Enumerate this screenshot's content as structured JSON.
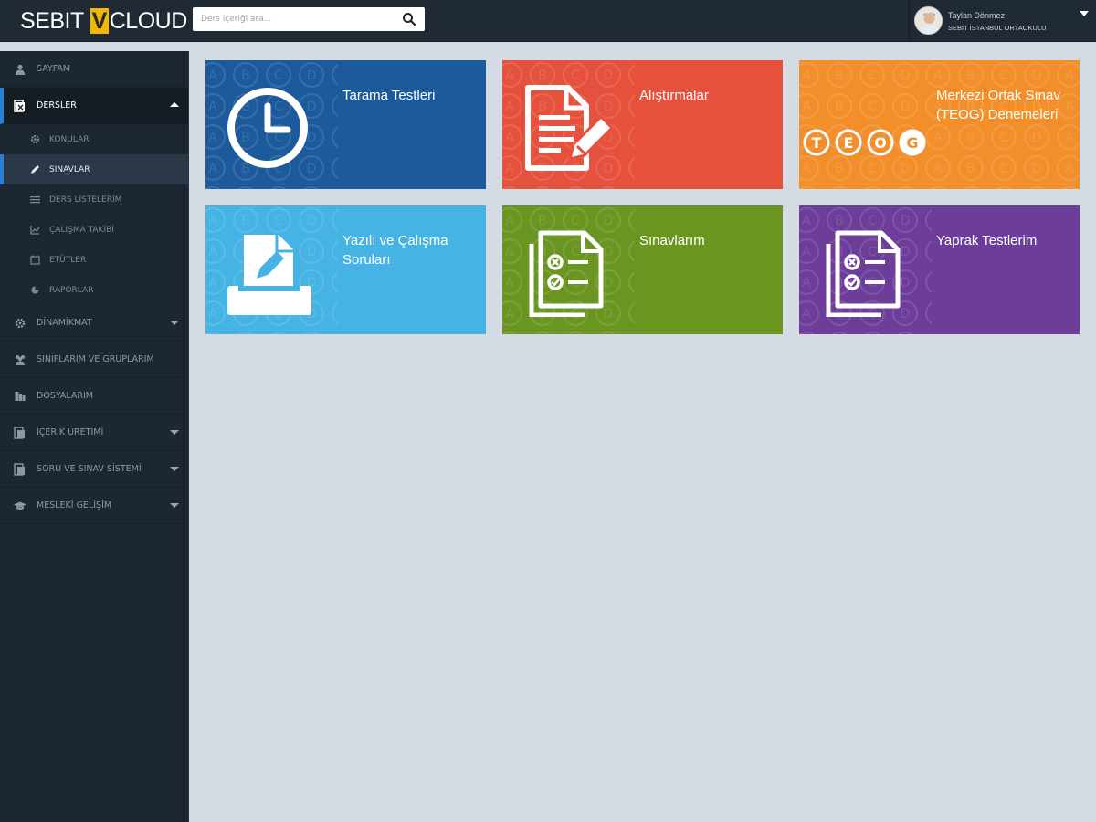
{
  "header": {
    "logo_left": "SEBIT",
    "logo_mark": "V",
    "logo_right": "CLOUD",
    "search_placeholder": "Ders içeriği ara...",
    "user_name": "Taylan Dönmez",
    "user_school": "SEBIT İSTANBUL ORTAOKULU"
  },
  "sidebar": {
    "items": [
      {
        "label": "SAYFAM",
        "icon": "user-icon"
      },
      {
        "label": "DERSLER",
        "icon": "book-icon",
        "active": true,
        "expanded": true
      },
      {
        "label": "KONULAR",
        "icon": "gear-icon"
      },
      {
        "label": "SINAVLAR",
        "icon": "pencil-icon",
        "active": true
      },
      {
        "label": "DERS LİSTELERİM",
        "icon": "list-icon"
      },
      {
        "label": "ÇALIŞMA TAKİBİ",
        "icon": "chart-icon"
      },
      {
        "label": "ETÜTLER",
        "icon": "calendar-icon"
      },
      {
        "label": "RAPORLAR",
        "icon": "report-icon"
      },
      {
        "label": "DİNAMİKMAT",
        "icon": "cog-icon"
      },
      {
        "label": "SINIFLARIM VE GRUPLARIM",
        "icon": "users-icon"
      },
      {
        "label": "DOSYALARIM",
        "icon": "files-icon"
      },
      {
        "label": "İÇERİK ÜRETİMİ",
        "icon": "content-icon"
      },
      {
        "label": "SORU VE SINAV SİSTEMİ",
        "icon": "question-icon"
      },
      {
        "label": "MESLEKİ GELİŞİM",
        "icon": "graduation-icon"
      }
    ]
  },
  "tiles": [
    {
      "label": "Tarama Testleri",
      "color": "#1c5a9c",
      "icon": "clock-icon"
    },
    {
      "label": "Alıştırmalar",
      "color": "#e5513d",
      "icon": "document-pencil-icon"
    },
    {
      "label": "Merkezi Ortak Sınav (TEOG) Denemeleri",
      "color": "#f28f2b",
      "icon": "teog-icon",
      "badges": [
        "T",
        "E",
        "O",
        "G"
      ]
    },
    {
      "label": "Yazılı ve Çalışma Soruları",
      "color": "#45b3e4",
      "icon": "printer-icon"
    },
    {
      "label": "Sınavlarım",
      "color": "#6a9521",
      "icon": "exam-papers-icon"
    },
    {
      "label": "Yaprak Testlerim",
      "color": "#6d3d9a",
      "icon": "worksheet-icon"
    }
  ],
  "pattern_letters": [
    "A",
    "B",
    "C",
    "D"
  ],
  "colors": {
    "topbar": "#1f2a35",
    "sidebar": "#1d2732",
    "content_bg": "#d5dbe2",
    "accent": "#2a7fd3",
    "logo_mark": "#f5b800"
  }
}
